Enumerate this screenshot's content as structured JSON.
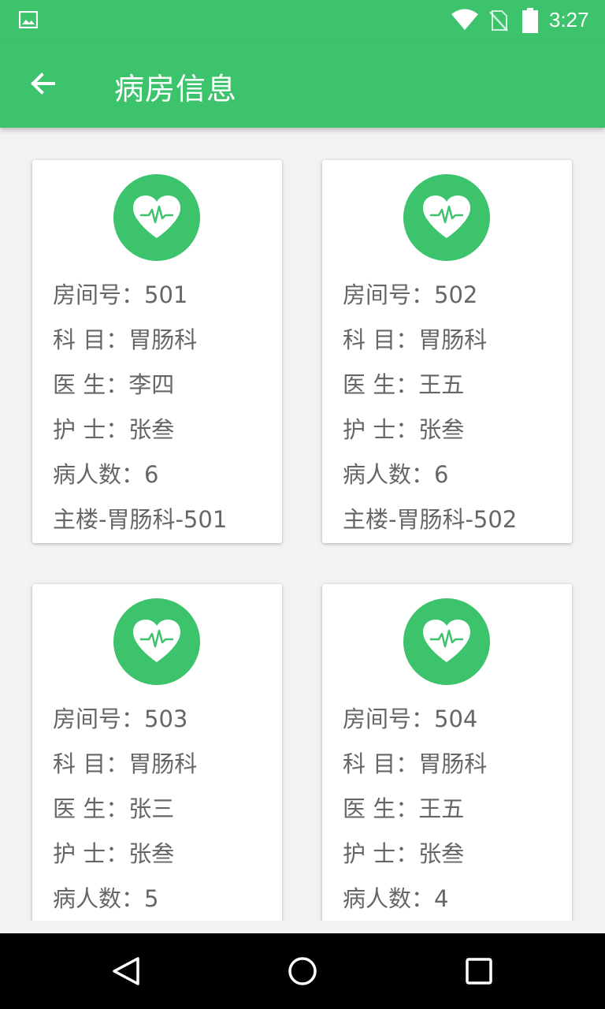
{
  "status_bar": {
    "time": "3:27",
    "icons": [
      "gallery-icon",
      "wifi-icon",
      "no-sim-icon",
      "battery-icon"
    ]
  },
  "app_bar": {
    "title": "病房信息",
    "back_icon": "arrow-left-icon"
  },
  "colors": {
    "primary": "#3dc36c",
    "text": "#666666",
    "background": "#f2f2f2"
  },
  "rooms": [
    {
      "icon": "heartbeat-icon",
      "room_label": "房间号：501",
      "dept_label": "科 目：胃肠科",
      "doctor_label": "医 生：李四",
      "nurse_label": "护 士：张叁",
      "patients_label": "病人数：6",
      "location_label": "主楼-胃肠科-501"
    },
    {
      "icon": "heartbeat-icon",
      "room_label": "房间号：502",
      "dept_label": "科 目：胃肠科",
      "doctor_label": "医 生：王五",
      "nurse_label": "护 士：张叁",
      "patients_label": "病人数：6",
      "location_label": "主楼-胃肠科-502"
    },
    {
      "icon": "heartbeat-icon",
      "room_label": "房间号：503",
      "dept_label": "科 目：胃肠科",
      "doctor_label": "医 生：张三",
      "nurse_label": "护 士：张叁",
      "patients_label": "病人数：5"
    },
    {
      "icon": "heartbeat-icon",
      "room_label": "房间号：504",
      "dept_label": "科 目：胃肠科",
      "doctor_label": "医 生：王五",
      "nurse_label": "护 士：张叁",
      "patients_label": "病人数：4"
    }
  ],
  "nav_bar": {
    "icons": [
      "nav-back-icon",
      "nav-home-icon",
      "nav-recent-icon"
    ]
  }
}
